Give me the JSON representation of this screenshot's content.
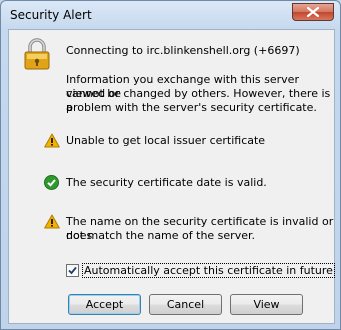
{
  "window": {
    "title": "Security Alert"
  },
  "icons": {
    "close": "close-icon",
    "lock": "padlock-icon",
    "warning": "warning-icon",
    "ok": "check-circle-icon"
  },
  "colors": {
    "warning": "#f2b203",
    "ok": "#2e9a2e"
  },
  "connection": {
    "text": "Connecting to irc.blinkenshell.org (+6697)"
  },
  "info": {
    "line1": "Information you exchange with this server cannot be",
    "line2": "viewed or changed by others. However, there is a",
    "line3": "problem with the server's security certificate."
  },
  "issues": [
    {
      "icon": "warning-icon",
      "lines": [
        "Unable to get local issuer certificate"
      ]
    },
    {
      "icon": "check-circle-icon",
      "lines": [
        "The security certificate date is valid."
      ]
    },
    {
      "icon": "warning-icon",
      "lines": [
        "The name on the security certificate is invalid or does",
        "not match the name of the server."
      ]
    }
  ],
  "auto_accept": {
    "label": "Automatically accept this certificate in future",
    "checked": true
  },
  "buttons": {
    "accept": "Accept",
    "cancel": "Cancel",
    "view": "View"
  }
}
